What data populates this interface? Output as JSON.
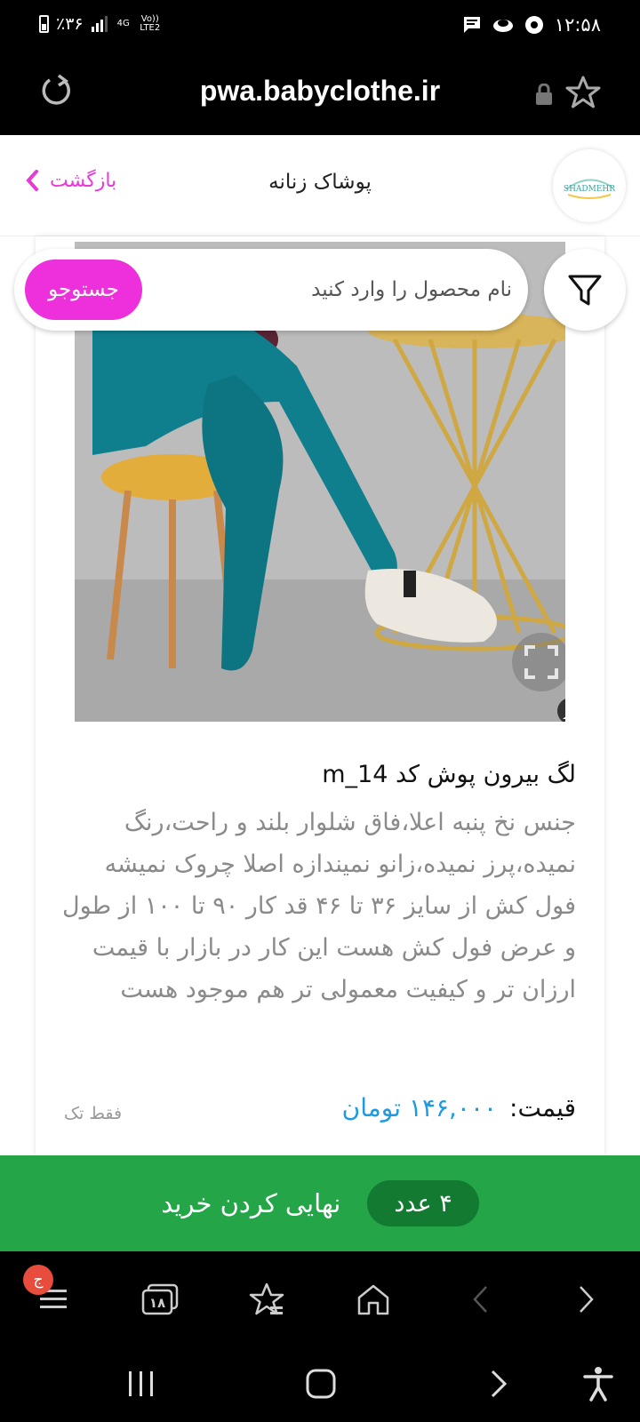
{
  "status_bar": {
    "battery": "٪۳۶",
    "network_4g": "4G",
    "network_volte": "Vo)) LTE2",
    "time": "۱۲:۵۸"
  },
  "browser": {
    "url": "pwa.babyclothe.ir"
  },
  "site_header": {
    "back_label": "بازگشت",
    "title": "پوشاک زنانه",
    "logo_text": "SHADMEHR"
  },
  "search": {
    "placeholder": "نام محصول را وارد کنید",
    "button_label": "جستوجو"
  },
  "product": {
    "title": "لگ بیرون پوش کد m_14",
    "description": "جنس نخ پنبه اعلا،فاق شلوار بلند و راحت،رنگ نمیده،پرز نمیده،زانو نمیندازه اصلا چروک نمیشه فول کش از سایز ۳۶ تا ۴۶ قد کار ۹۰ تا ۱۰۰ از طول و عرض فول کش هست این کار در بازار با قیمت ارزان تر و کیفیت معمولی تر هم موجود هست",
    "price_label": "قیمت:",
    "price_value": "۱۴۶,۰۰۰ تومان",
    "sale_note": "فقط تک"
  },
  "checkout": {
    "label": "نهایی کردن خرید",
    "count": "۴ عدد"
  },
  "browser_nav": {
    "menu_badge": "ج",
    "tabs_count": "۱۸"
  },
  "colors": {
    "accent_pink": "#ee2fdc",
    "price_blue": "#1e9be0",
    "checkout_green": "#23a548"
  }
}
